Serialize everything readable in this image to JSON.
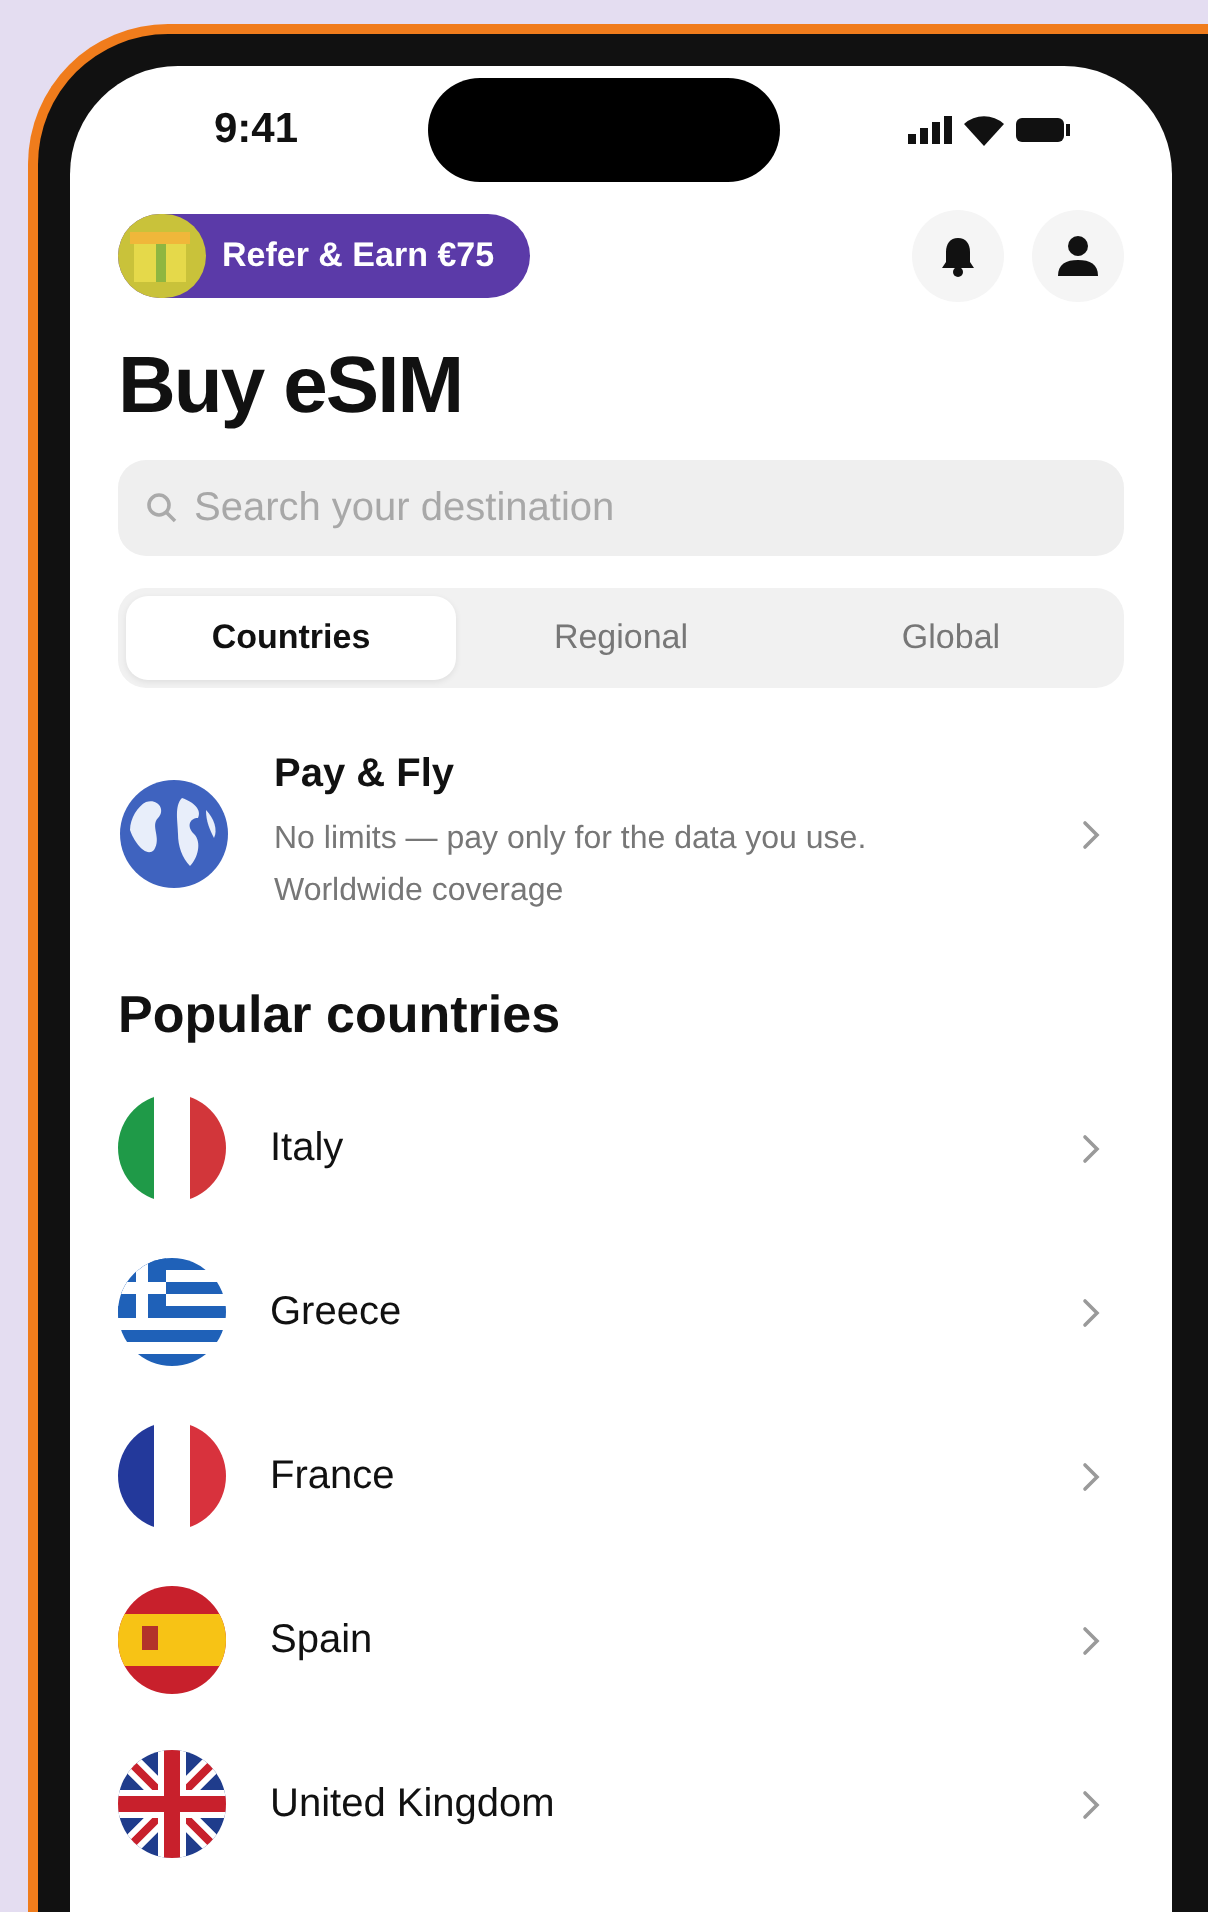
{
  "status_bar": {
    "time": "9:41"
  },
  "referral": {
    "label": "Refer & Earn €75"
  },
  "title": "Buy eSIM",
  "search": {
    "placeholder": "Search your destination"
  },
  "tabs": [
    {
      "label": "Countries",
      "selected": true
    },
    {
      "label": "Regional",
      "selected": false
    },
    {
      "label": "Global",
      "selected": false
    }
  ],
  "pay_and_fly": {
    "title": "Pay & Fly",
    "description": "No limits — pay only for the data you use. Worldwide coverage"
  },
  "popular": {
    "heading": "Popular countries",
    "countries": [
      {
        "name": "Italy"
      },
      {
        "name": "Greece"
      },
      {
        "name": "France"
      },
      {
        "name": "Spain"
      },
      {
        "name": "United Kingdom"
      }
    ]
  }
}
